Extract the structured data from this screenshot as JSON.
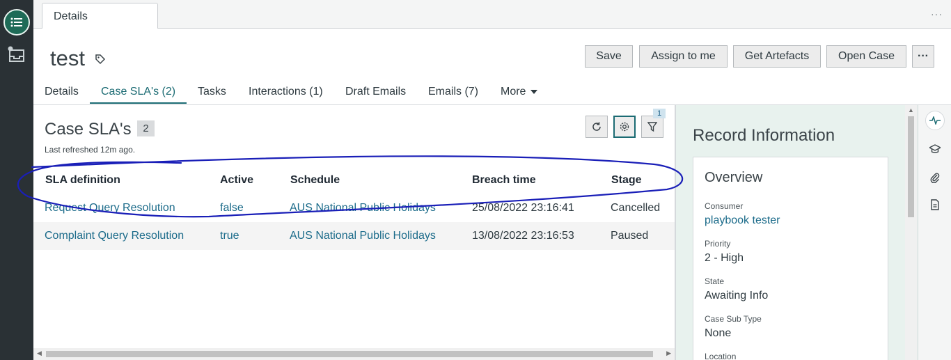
{
  "tabbar": {
    "doc_tab_label": "Details",
    "more_label": "···"
  },
  "header": {
    "title": "test",
    "buttons": {
      "save": "Save",
      "assign": "Assign to me",
      "artefacts": "Get Artefacts",
      "open_case": "Open Case",
      "more": "···"
    }
  },
  "subtabs": {
    "details": "Details",
    "case_slas": "Case SLA's (2)",
    "tasks": "Tasks",
    "interactions": "Interactions (1)",
    "draft_emails": "Draft Emails",
    "emails": "Emails (7)",
    "more": "More",
    "active": "case_slas"
  },
  "main": {
    "title": "Case SLA's",
    "count": "2",
    "last_refreshed": "Last refreshed 12m ago.",
    "filter_badge": "1",
    "columns": {
      "sla": "SLA definition",
      "active": "Active",
      "schedule": "Schedule",
      "breach": "Breach time",
      "stage": "Stage"
    },
    "rows": [
      {
        "sla": "Request Query Resolution",
        "active": "false",
        "schedule": "AUS National Public Holidays",
        "breach": "25/08/2022 23:16:41",
        "stage": "Cancelled"
      },
      {
        "sla": "Complaint Query Resolution",
        "active": "true",
        "schedule": "AUS National Public Holidays",
        "breach": "13/08/2022 23:16:53",
        "stage": "Paused"
      }
    ]
  },
  "record_info": {
    "title": "Record Information",
    "overview_title": "Overview",
    "fields": {
      "consumer": {
        "label": "Consumer",
        "value": "playbook tester"
      },
      "priority": {
        "label": "Priority",
        "value": "2 - High"
      },
      "state": {
        "label": "State",
        "value": "Awaiting Info"
      },
      "sub_type": {
        "label": "Case Sub Type",
        "value": "None"
      },
      "location": {
        "label": "Location"
      }
    }
  },
  "colors": {
    "accent": "#1b6b73",
    "link": "#1b6b8a",
    "rail": "#2a3135",
    "rail_active": "#1e6b57",
    "right_panel": "#e8f2ee",
    "annotation_ink": "#1a1fb8"
  },
  "icons": {
    "rail_main": "list-icon",
    "rail_inbox": "inbox-icon",
    "tag": "tag-icon",
    "refresh": "refresh-icon",
    "settings": "gear-icon",
    "filter": "filter-icon",
    "activity": "activity-icon",
    "education": "graduation-cap-icon",
    "attachment": "paperclip-icon",
    "document": "document-icon"
  }
}
